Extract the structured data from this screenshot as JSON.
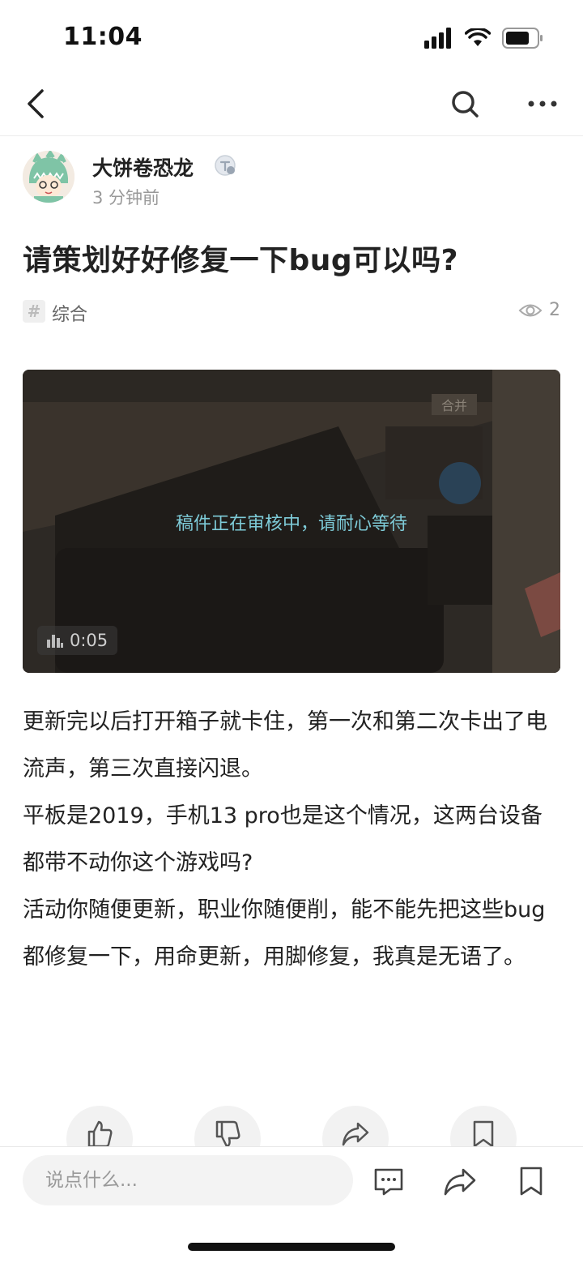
{
  "status_bar": {
    "time": "11:04"
  },
  "author": {
    "name": "大饼卷恐龙",
    "time_ago": "3 分钟前"
  },
  "post": {
    "title": "请策划好好修复一下bug可以吗?",
    "topic_icon": "#",
    "topic": "综合",
    "views": "2",
    "video": {
      "status_text": "稿件正在审核中，请耐心等待",
      "duration": "0:05"
    },
    "body": [
      "更新完以后打开箱子就卡住，第一次和第二次卡出了电流声，第三次直接闪退。",
      "平板是2019，手机13 pro也是这个情况，这两台设备都带不动你这个游戏吗?",
      "活动你随便更新，职业你随便削，能不能先把这些bug都修复一下，用命更新，用脚修复，我真是无语了。"
    ]
  },
  "bottom_bar": {
    "comment_placeholder": "说点什么..."
  },
  "icons": [
    "back-icon",
    "search-icon",
    "more-icon",
    "badge-icon",
    "eye-icon",
    "bar-chart-icon",
    "like-icon",
    "dislike-icon",
    "share-icon",
    "bookmark-icon",
    "comment-icon"
  ]
}
